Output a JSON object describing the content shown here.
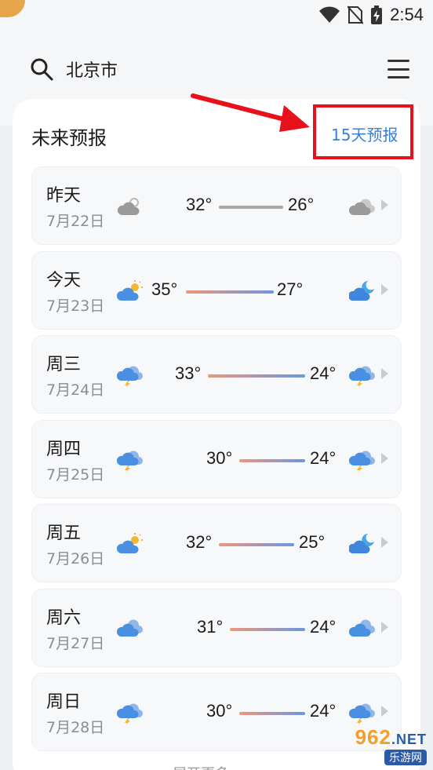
{
  "status": {
    "time": "2:54"
  },
  "header": {
    "city": "北京市"
  },
  "forecast": {
    "title": "未来预报",
    "link_15": "15天预报",
    "days": [
      {
        "day": "昨天",
        "date": "7月22日",
        "high": "32°",
        "low": "26°",
        "day_icon": "partly-cloudy-gray-icon",
        "night_icon": "cloudy-gray-icon"
      },
      {
        "day": "今天",
        "date": "7月23日",
        "high": "35°",
        "low": "27°",
        "day_icon": "partly-sunny-icon",
        "night_icon": "moon-cloud-icon"
      },
      {
        "day": "周三",
        "date": "7月24日",
        "high": "33°",
        "low": "24°",
        "day_icon": "thunderstorm-icon",
        "night_icon": "thunderstorm-icon"
      },
      {
        "day": "周四",
        "date": "7月25日",
        "high": "30°",
        "low": "24°",
        "day_icon": "thunderstorm-icon",
        "night_icon": "thunderstorm-icon"
      },
      {
        "day": "周五",
        "date": "7月26日",
        "high": "32°",
        "low": "25°",
        "day_icon": "partly-sunny-icon",
        "night_icon": "moon-cloud-icon"
      },
      {
        "day": "周六",
        "date": "7月27日",
        "high": "31°",
        "low": "24°",
        "day_icon": "cloudy-icon",
        "night_icon": "cloudy-icon"
      },
      {
        "day": "周日",
        "date": "7月28日",
        "high": "30°",
        "low": "24°",
        "day_icon": "thunderstorm-icon",
        "night_icon": "thunderstorm-icon"
      }
    ]
  },
  "bottom": {
    "more": "展开更多"
  },
  "watermark": {
    "brand": "962",
    "net": ".NET",
    "sub": "乐游网"
  },
  "colors": {
    "accent": "#3b7ed6",
    "annotation": "#e8101a",
    "bar_warm": "#f0957a",
    "bar_cool": "#6b97e0"
  }
}
